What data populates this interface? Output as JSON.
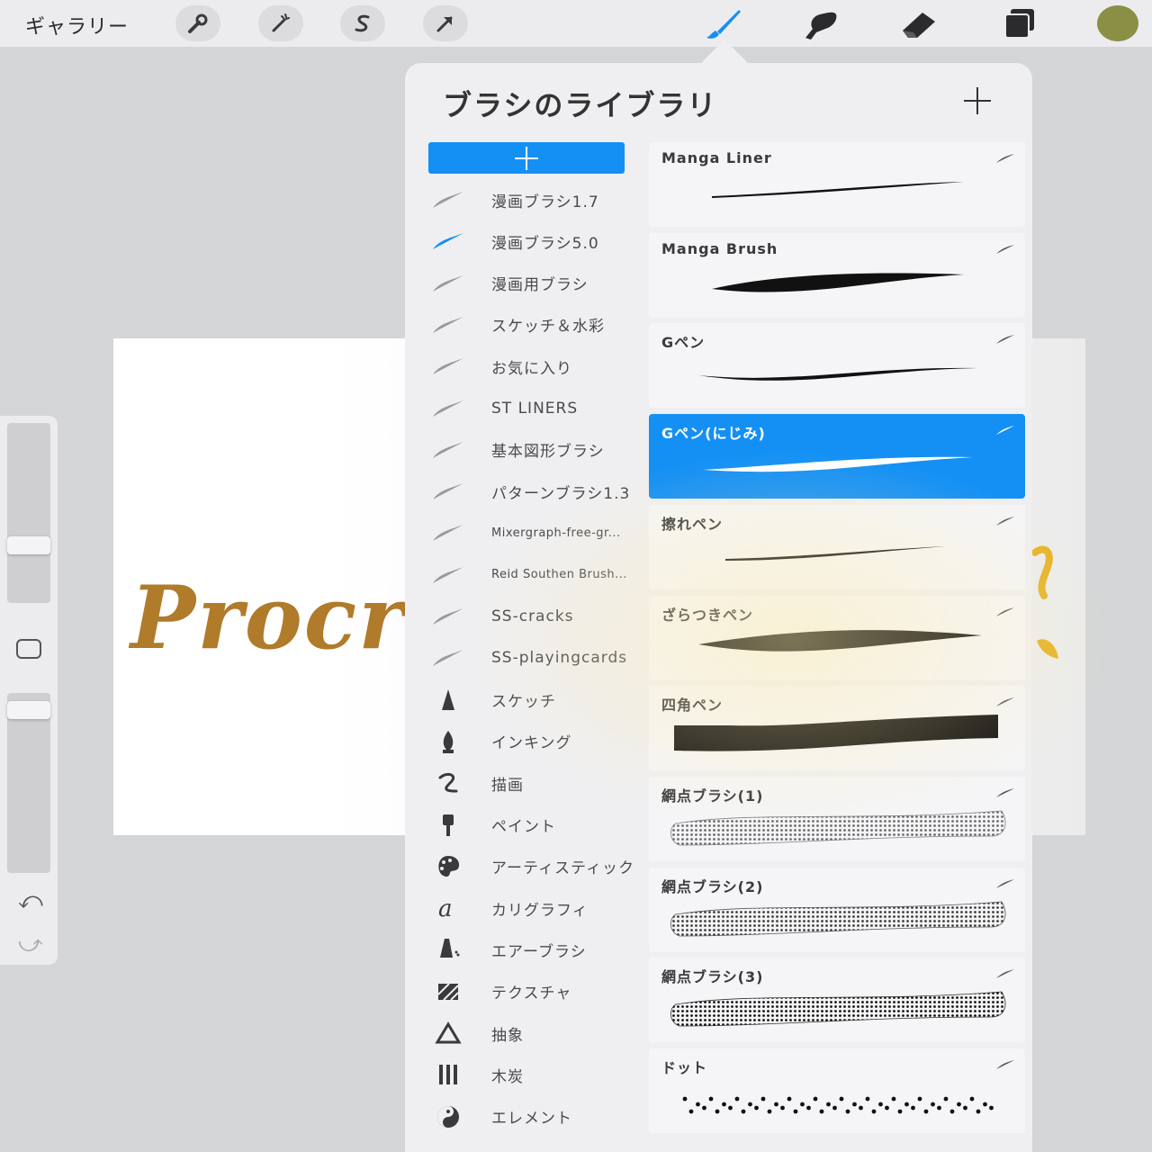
{
  "topbar": {
    "gallery_label": "ギャラリー",
    "left_tools": [
      {
        "name": "actions-wrench-icon"
      },
      {
        "name": "adjustments-wand-icon"
      },
      {
        "name": "selection-s-icon"
      },
      {
        "name": "transform-arrow-icon"
      }
    ],
    "right_tools": [
      {
        "name": "brush-icon",
        "active": true
      },
      {
        "name": "smudge-icon",
        "active": false
      },
      {
        "name": "eraser-icon",
        "active": false
      },
      {
        "name": "layers-icon",
        "active": false
      }
    ],
    "current_color": "#8b8f45",
    "accent_color": "#1490f5"
  },
  "canvas": {
    "text": "Procre"
  },
  "sidebar": {
    "brush_size_level": 0.3,
    "opacity_level": 0.95,
    "undo_icon": "undo-icon",
    "redo_icon": "redo-icon"
  },
  "library": {
    "title": "ブラシのライブラリ",
    "add_set_icon": "plus-icon",
    "categories": [
      {
        "label": "漫画ブラシ1.7",
        "icon": "stroke",
        "selected": false
      },
      {
        "label": "漫画ブラシ5.0",
        "icon": "stroke",
        "selected": true
      },
      {
        "label": "漫画用ブラシ",
        "icon": "stroke",
        "selected": false
      },
      {
        "label": "スケッチ＆水彩",
        "icon": "stroke",
        "selected": false
      },
      {
        "label": "お気に入り",
        "icon": "stroke",
        "selected": false
      },
      {
        "label": "ST LINERS",
        "icon": "stroke",
        "selected": false
      },
      {
        "label": "基本図形ブラシ",
        "icon": "stroke",
        "selected": false
      },
      {
        "label": "パターンブラシ1.3",
        "icon": "stroke",
        "selected": false
      },
      {
        "label": "Mixergraph-free-gr...",
        "icon": "stroke",
        "selected": false,
        "small": true
      },
      {
        "label": "Reid Southen Brush...",
        "icon": "stroke",
        "selected": false,
        "small": true
      },
      {
        "label": "SS-cracks",
        "icon": "stroke",
        "selected": false
      },
      {
        "label": "SS-playingcards",
        "icon": "stroke",
        "selected": false
      },
      {
        "label": "スケッチ",
        "icon": "pencil",
        "selected": false
      },
      {
        "label": "インキング",
        "icon": "nib",
        "selected": false
      },
      {
        "label": "描画",
        "icon": "swirl",
        "selected": false
      },
      {
        "label": "ペイント",
        "icon": "paintbrush",
        "selected": false
      },
      {
        "label": "アーティスティック",
        "icon": "palette",
        "selected": false
      },
      {
        "label": "カリグラフィ",
        "icon": "calligraphy",
        "selected": false
      },
      {
        "label": "エアーブラシ",
        "icon": "airbrush",
        "selected": false
      },
      {
        "label": "テクスチャ",
        "icon": "texture",
        "selected": false
      },
      {
        "label": "抽象",
        "icon": "triangle",
        "selected": false
      },
      {
        "label": "木炭",
        "icon": "charcoal",
        "selected": false
      },
      {
        "label": "エレメント",
        "icon": "yinyang",
        "selected": false
      }
    ],
    "brushes": [
      {
        "name": "Manga Liner",
        "stroke": "liner",
        "selected": false
      },
      {
        "name": "Manga Brush",
        "stroke": "brush",
        "selected": false
      },
      {
        "name": "Gペン",
        "stroke": "gpen",
        "selected": false
      },
      {
        "name": "Gペン(にじみ)",
        "stroke": "nijimi",
        "selected": true
      },
      {
        "name": "擦れペン",
        "stroke": "kasure",
        "selected": false
      },
      {
        "name": "ざらつきペン",
        "stroke": "zaratsuki",
        "selected": false
      },
      {
        "name": "四角ペン",
        "stroke": "square",
        "selected": false
      },
      {
        "name": "網点ブラシ(1)",
        "stroke": "tone1",
        "selected": false
      },
      {
        "name": "網点ブラシ(2)",
        "stroke": "tone2",
        "selected": false
      },
      {
        "name": "網点ブラシ(3)",
        "stroke": "tone3",
        "selected": false
      },
      {
        "name": "ドット",
        "stroke": "dots",
        "selected": false
      }
    ]
  }
}
